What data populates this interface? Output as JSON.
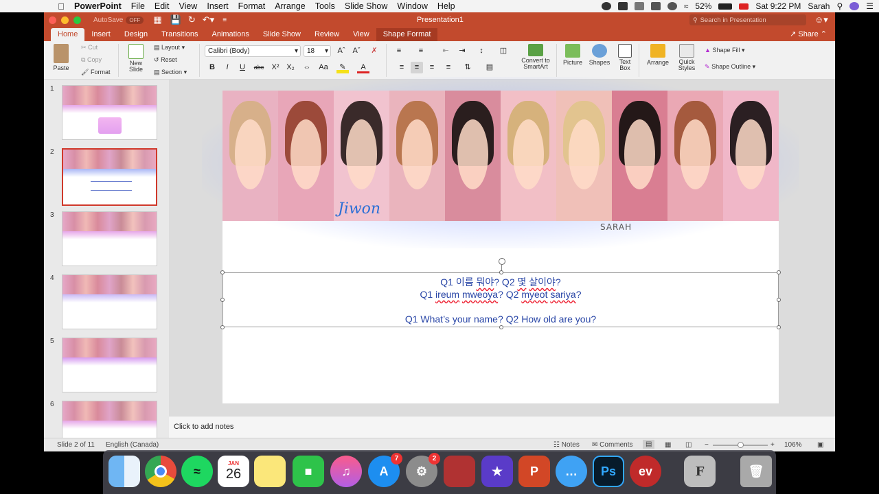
{
  "menubar": {
    "app_name": "PowerPoint",
    "items": [
      "File",
      "Edit",
      "View",
      "Insert",
      "Format",
      "Arrange",
      "Tools",
      "Slide Show",
      "Window",
      "Help"
    ],
    "battery": "52%",
    "clock": "Sat 9:22 PM",
    "user": "Sarah"
  },
  "titlebar": {
    "autosave_label": "AutoSave",
    "autosave_state": "OFF",
    "title": "Presentation1",
    "search_placeholder": "Search in Presentation"
  },
  "ribbon_tabs": [
    "Home",
    "Insert",
    "Design",
    "Transitions",
    "Animations",
    "Slide Show",
    "Review",
    "View",
    "Shape Format"
  ],
  "share_label": "Share",
  "ribbon": {
    "paste": "Paste",
    "cut": "Cut",
    "copy": "Copy",
    "format": "Format",
    "new_slide": "New Slide",
    "layout": "Layout",
    "reset": "Reset",
    "section": "Section",
    "font_name": "Calibri (Body)",
    "font_size": "18",
    "convert_smartart": "Convert to SmartArt",
    "picture": "Picture",
    "shapes": "Shapes",
    "text_box": "Text Box",
    "arrange": "Arrange",
    "quick_styles": "Quick Styles",
    "shape_fill": "Shape Fill",
    "shape_outline": "Shape Outline"
  },
  "thumbnails": [
    "1",
    "2",
    "3",
    "4",
    "5",
    "6"
  ],
  "slide": {
    "signature": "SARAH",
    "photo_caption": "Jiwon",
    "line1_a": "Q1 이름 ",
    "line1_b": "뭐야",
    "line1_c": "? Q2 ",
    "line1_d": "몇",
    "line1_e": " ",
    "line1_f": "살이야",
    "line1_g": "?",
    "line2_a": "Q1 ",
    "line2_b": "ireum",
    "line2_c": " ",
    "line2_d": "mweoya",
    "line2_e": "? Q2 ",
    "line2_f": "myeot",
    "line2_g": " ",
    "line2_h": "sariya",
    "line2_i": "?",
    "line3": "Q1 What’s your name? Q2 How old are you?"
  },
  "notes_placeholder": "Click to add notes",
  "status": {
    "slide_of": "Slide 2 of 11",
    "language": "English (Canada)",
    "notes": "Notes",
    "comments": "Comments",
    "zoom": "106%"
  },
  "dock": {
    "calendar_month": "JAN",
    "calendar_day": "26",
    "appstore_badge": "7",
    "prefs_badge": "2"
  },
  "colors": {
    "ppt_red": "#c24a2d",
    "text_blue": "#2845a6"
  }
}
